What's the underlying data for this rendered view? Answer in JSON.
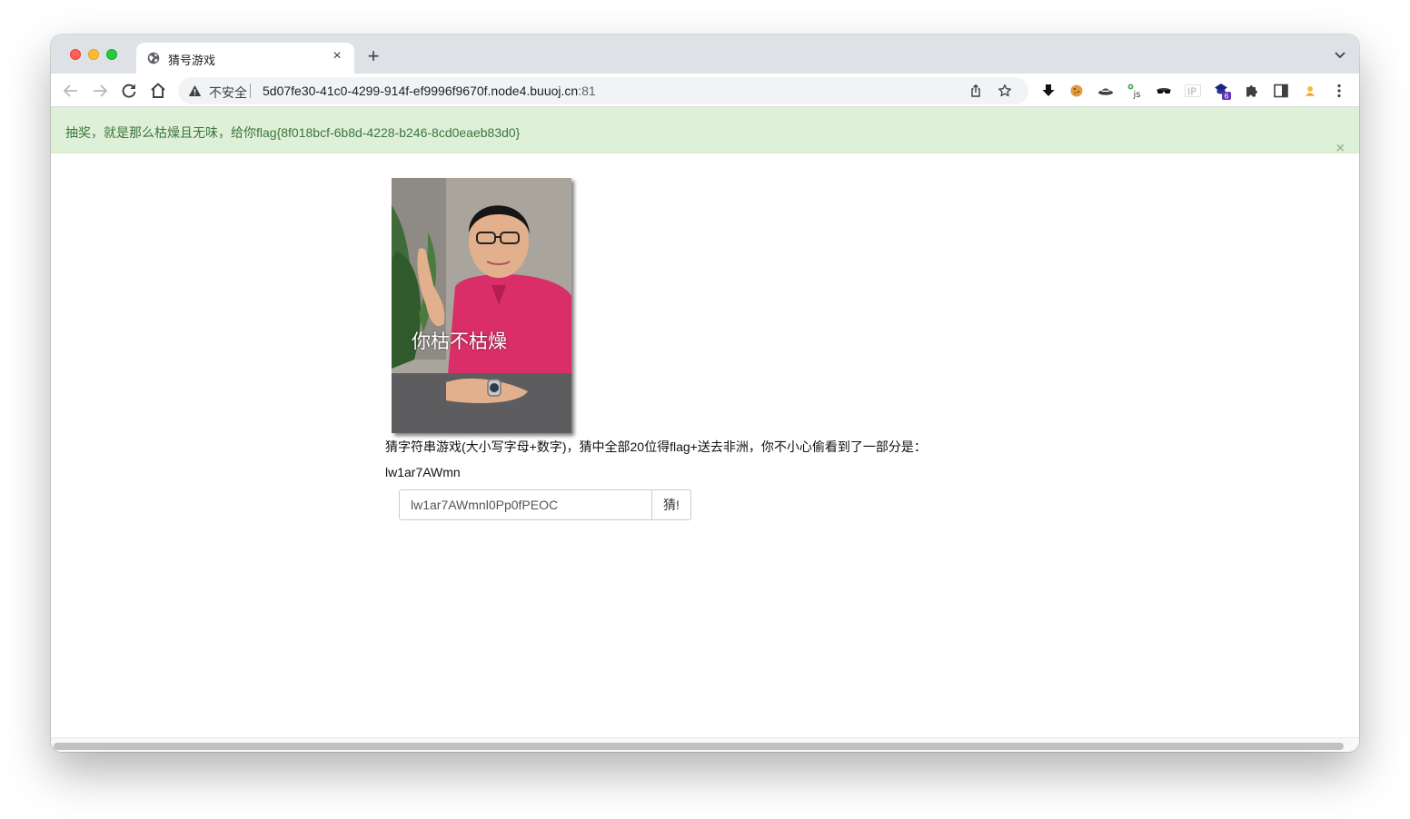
{
  "browser": {
    "tab_title": "猜号游戏",
    "security_label": "不安全",
    "url_host": "5d07fe30-41c0-4299-914f-ef9996f9670f.node4.buuoj.cn",
    "url_port": ":81",
    "tab_close_glyph": "×",
    "new_tab_glyph": "+",
    "extensions": [
      "download-icon",
      "cookie-icon",
      "hat-icon",
      "js-icon",
      "spy-glasses-icon",
      "ip-icon",
      "ext-badge-icon",
      "puzzle-icon",
      "sidepanel-icon",
      "profile-icon",
      "menu-icon"
    ],
    "ext_ip_label": "IP",
    "ext_js_label": "js",
    "ext_badge_count": "6"
  },
  "alert": {
    "message": "抽奖，就是那么枯燥且无味，给你flag{8f018bcf-6b8d-4228-b246-8cd0eaeb83d0}",
    "close_glyph": "×"
  },
  "main": {
    "meme_caption": "你枯不枯燥",
    "description": "猜字符串游戏(大小写字母+数字)，猜中全部20位得flag+送去非洲，你不小心偷看到了一部分是：",
    "partial_string": "lw1ar7AWmn",
    "guess_value": "lw1ar7AWmnl0Pp0fPEOC",
    "guess_button": "猜!"
  },
  "colors": {
    "alert_bg": "#dff0d8",
    "alert_text": "#3c763d"
  }
}
